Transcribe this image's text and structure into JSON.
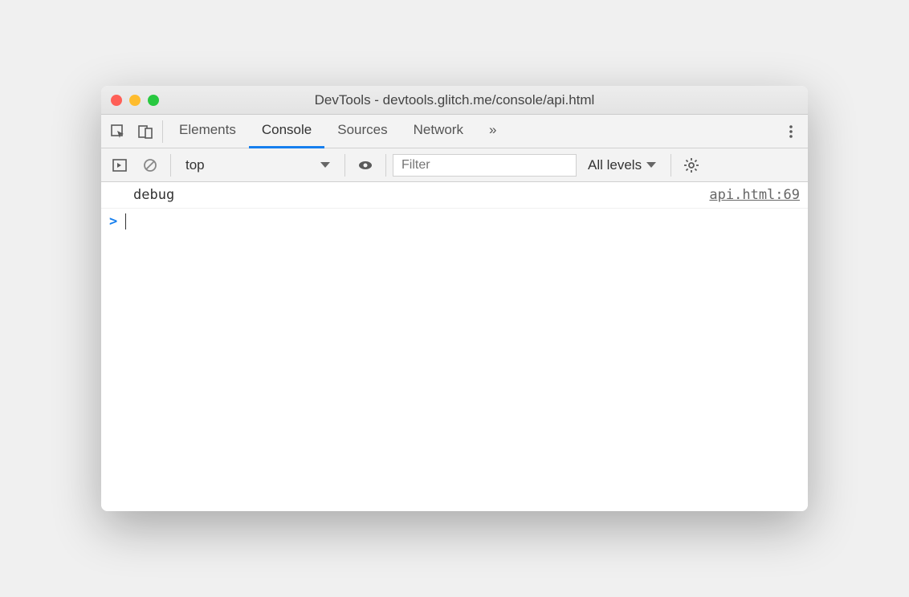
{
  "window": {
    "title": "DevTools - devtools.glitch.me/console/api.html"
  },
  "tabs": {
    "items": [
      "Elements",
      "Console",
      "Sources",
      "Network"
    ],
    "active": "Console",
    "overflow": "»"
  },
  "toolbar": {
    "context": "top",
    "filter_placeholder": "Filter",
    "log_levels": "All levels"
  },
  "console": {
    "messages": [
      {
        "text": "debug",
        "source": "api.html:69"
      }
    ],
    "prompt": ">"
  }
}
